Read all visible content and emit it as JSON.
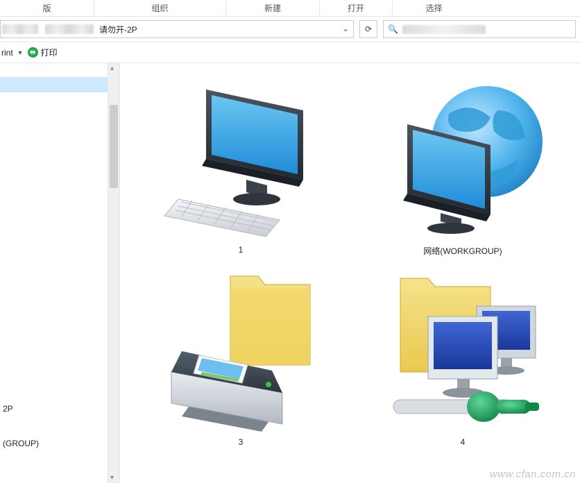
{
  "ribbon": {
    "groups": [
      "版",
      "组织",
      "新建",
      "打开",
      "选择"
    ]
  },
  "address": {
    "suffix": "请勿开-2P"
  },
  "toolbar": {
    "print_left": "rint",
    "print_right": "打印"
  },
  "nav": {
    "item_2p": "2P",
    "item_workgroup": "(GROUP)"
  },
  "items": {
    "i1": "1",
    "i2": "网络(WORKGROUP)",
    "i3": "3",
    "i4": "4"
  },
  "watermark": "www.cfan.com.cn"
}
